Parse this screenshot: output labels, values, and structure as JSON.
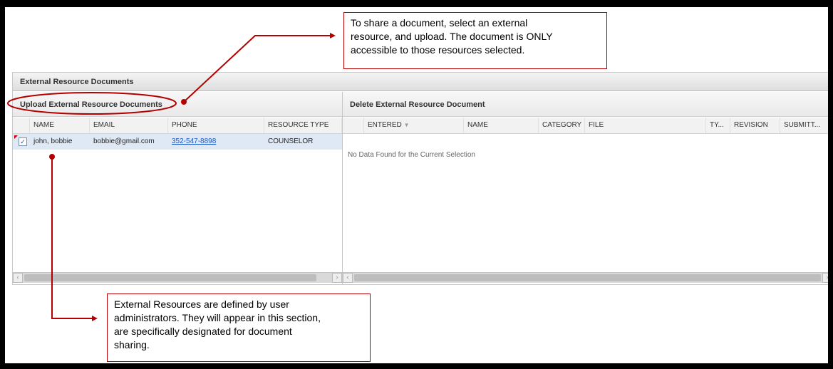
{
  "callouts": {
    "top_line1": "To share a document, select an external",
    "top_line2": "resource, and upload. The document is ONLY",
    "top_line3": "accessible to those resources selected.",
    "bottom_line1": "External Resources are defined by user",
    "bottom_line2": "administrators. They will appear in this section,",
    "bottom_line3": "are specifically designated for document",
    "bottom_line4": "sharing."
  },
  "panel": {
    "title": "External Resource Documents"
  },
  "upload_section": {
    "title": "Upload External Resource Documents",
    "columns": [
      "NAME",
      "EMAIL",
      "PHONE",
      "RESOURCE TYPE"
    ],
    "rows": [
      {
        "checked": true,
        "check_glyph": "✓",
        "name": "john, bobbie",
        "email": "bobbie@gmail.com",
        "phone": "352-547-8898",
        "resource_type": "COUNSELOR"
      }
    ]
  },
  "delete_section": {
    "title": "Delete External Resource Document",
    "columns": [
      "ENTERED",
      "NAME",
      "CATEGORY",
      "FILE",
      "TY...",
      "REVISION",
      "SUBMITT..."
    ],
    "sort_indicator": "▼",
    "empty_message": "No Data Found for the Current Selection"
  },
  "scroll_glyphs": {
    "left": "‹",
    "right": "›"
  },
  "colors": {
    "accent_red": "#b40000",
    "selected_row": "#dfe9f5",
    "link": "#1a58c8"
  }
}
